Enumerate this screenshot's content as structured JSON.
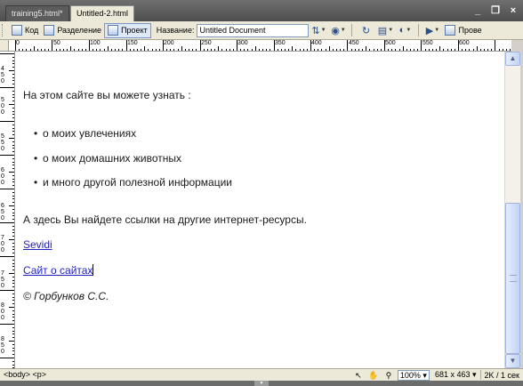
{
  "tabs": [
    {
      "label": "training5.html*",
      "active": false
    },
    {
      "label": "Untitled-2.html",
      "active": true
    }
  ],
  "window_controls": {
    "minimize": "_",
    "restore": "❐",
    "close": "×"
  },
  "toolbar": {
    "code_label": "Код",
    "split_label": "Разделение",
    "design_label": "Проект",
    "title_label": "Название:",
    "title_value": "Untitled Document",
    "check_label": "Прове"
  },
  "ruler": {
    "h_labels": [
      "0",
      "50",
      "100",
      "150",
      "200",
      "250",
      "300",
      "350",
      "400",
      "450",
      "500",
      "550",
      "600"
    ],
    "v_labels": [
      "4 5 0",
      "5 0 0",
      "5 5 0",
      "6 0 0",
      "6 5 0",
      "7 0 0",
      "7 5 0",
      "8 0 0",
      "8 5 0"
    ]
  },
  "document": {
    "intro": "На этом сайте вы можете узнать :",
    "bullets": [
      "о моих увлечениях",
      "о моих домашних животных",
      "и много другой полезной информации"
    ],
    "links_intro": "А здесь Вы найдете ссылки на другие интернет-ресурсы.",
    "link1": "Sevidi",
    "link2": "Сайт о сайтах",
    "copyright": "© Горбунков С.С."
  },
  "status": {
    "tag_path": "<body> <p>",
    "zoom": "100%",
    "dimensions": "681 x 463",
    "download": "2K / 1 сек"
  },
  "colors": {
    "link": "#1f1fbf",
    "chrome": "#ece9d8"
  }
}
